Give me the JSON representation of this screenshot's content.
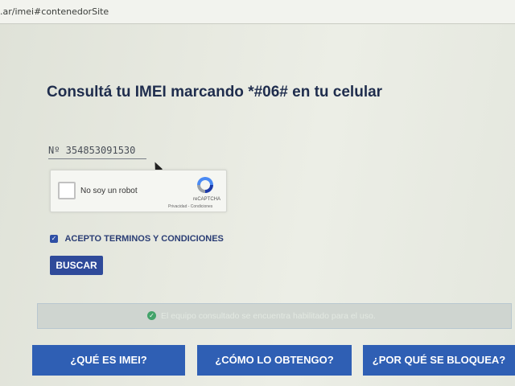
{
  "browser": {
    "url": ".ar/imei#contenedorSite"
  },
  "page": {
    "title": "Consultá tu IMEI marcando *#06# en tu celular",
    "imei_field": {
      "value": "Nº 354853091530"
    },
    "recaptcha": {
      "label": "No soy un robot",
      "brand": "reCAPTCHA",
      "links": "Privacidad - Condiciones"
    },
    "terms": {
      "label": "ACEPTO TERMINOS Y CONDICIONES",
      "checked": true
    },
    "search_button": "BUSCAR",
    "status": {
      "text": "El equipo consultado se encuentra habilitado para el uso.",
      "color": "#43a36a"
    },
    "nav": [
      "¿QUÉ ES IMEI?",
      "¿CÓMO LO OBTENGO?",
      "¿POR QUÉ SE BLOQUEA?"
    ]
  },
  "colors": {
    "brand": "#2f5fb4",
    "title": "#1f2d4d",
    "button": "#2f4a9a"
  }
}
